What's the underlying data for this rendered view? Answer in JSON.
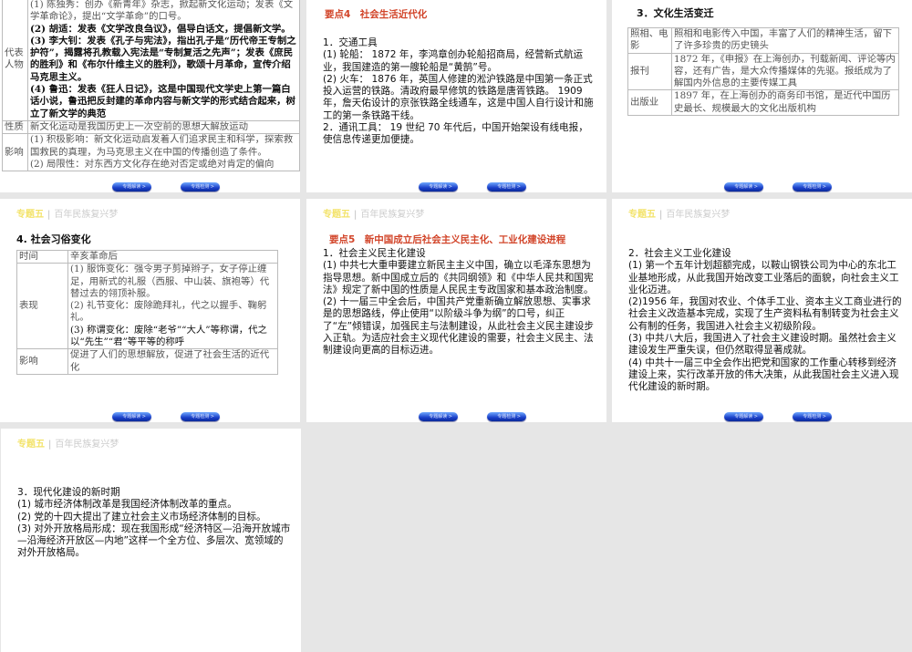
{
  "header": {
    "topic": "专题五",
    "separator": "|",
    "subtitle": "百年民族复兴梦"
  },
  "buttons": {
    "prev": "专题解读 >",
    "next": "专题检测 >"
  },
  "slide1": {
    "rep_label": "代表人物",
    "rep_items": [
      "(1) 陈独秀：创办《新青年》杂志，掀起新文化运动；发表《文学革命论》，提出“文学革命”的口号。",
      "(2) 胡适：发表《文学改良刍议》，倡导白话文，提倡新文学。",
      "(3) 李大钊：发表《孔子与宪法》，指出孔子是“历代帝王专制之护符”，揭露将孔教载入宪法是“专制复活之先声”；发表《庶民的胜利》和《布尔什维主义的胜利》，歌颂十月革命，宣传介绍马克思主义。",
      "(4) 鲁迅：发表《狂人日记》，这是中国现代文学史上第一篇白话小说，鲁迅把反封建的革命内容与新文学的形式结合起来，树立了新文学的典范"
    ],
    "nature_label": "性质",
    "nature": "新文化运动是我国历史上一次空前的思想大解放运动",
    "impact_label": "影响",
    "impact_items": [
      "(1) 积极影响：新文化运动启发着人们追求民主和科学，探索救国救民的真理，为马克思主义在中国的传播创造了条件。",
      "(2) 局限性：对东西方文化存在绝对否定或绝对肯定的偏向"
    ]
  },
  "slide2": {
    "title": "要点4　社会生活近代化",
    "paras": [
      "1．交通工具",
      "(1) 轮船： 1872 年，李鸿章创办轮船招商局，经营新式航运业，我国建造的第一艘轮船是“黄鹄”号。",
      "(2) 火车： 1876 年，英国人修建的淞沪铁路是中国第一条正式投入运营的铁路。清政府最早修筑的铁路是唐胥铁路。 1909 年，詹天佑设计的京张铁路全线通车，这是中国人自行设计和施工的第一条铁路干线。",
      "2．通讯工具： 19 世纪 70 年代后，中国开始架设有线电报，使信息传递更加便捷。"
    ]
  },
  "slide3": {
    "title": "3．文化生活变迁",
    "rows": [
      [
        "照相、电影",
        "照相和电影传入中国，丰富了人们的精神生活，留下了许多珍贵的历史镜头"
      ],
      [
        "报刊",
        "1872 年，《申报》在上海创办，刊载新闻、评论等内容，还有广告，是大众传播媒体的先驱。报纸成为了解国内外信息的主要传媒工具"
      ],
      [
        "出版业",
        "1897 年，在上海创办的商务印书馆，是近代中国历史最长、规模最大的文化出版机构"
      ]
    ]
  },
  "slide4": {
    "title": "4. 社会习俗变化",
    "time_label": "时间",
    "time": "辛亥革命后",
    "show_label": "表现",
    "show_items": [
      "(1) 服饰变化：强令男子剪掉辫子，女子停止缠足，用新式的礼服（西服、中山装、旗袍等）代替过去的翎顶补服。",
      "(2) 礼节变化：废除跪拜礼，代之以握手、鞠躬礼。",
      "(3) 称谓变化：废除“老爷”“大人”等称谓，代之以“先生”“君”等平等的称呼"
    ],
    "impact_label": "影响",
    "impact": "促进了人们的思想解放，促进了社会生活的近代化"
  },
  "slide5": {
    "title": "要点5　新中国成立后社会主义民主化、工业化建设进程",
    "paras": [
      "1．社会主义民主化建设",
      "(1) 中共七大重申要建立新民主主义中国，确立以毛泽东思想为指导思想。新中国成立后的《共同纲领》和《中华人民共和国宪法》规定了新中国的性质是人民民主专政国家和基本政治制度。",
      "(2) 十一届三中全会后，中国共产党重新确立解放思想、实事求是的思想路线，停止使用“以阶级斗争为纲”的口号，纠正了“左”倾错误，加强民主与法制建设，从此社会主义民主建设步入正轨。为适应社会主义现代化建设的需要，社会主义民主、法制建设向更高的目标迈进。"
    ]
  },
  "slide6": {
    "paras": [
      "2．社会主义工业化建设",
      "(1) 第一个五年计划超额完成，以鞍山钢铁公司为中心的东北工业基地形成，从此我国开始改变工业落后的面貌，向社会主义工业化迈进。",
      "(2)1956 年，我国对农业、个体手工业、资本主义工商业进行的社会主义改造基本完成，实现了生产资料私有制转变为社会主义公有制的任务，我国进入社会主义初级阶段。",
      "(3) 中共八大后，我国进入了社会主义建设时期。虽然社会主义建设发生严重失误，但仍然取得显著成就。",
      "(4) 中共十一届三中全会作出把党和国家的工作重心转移到经济建设上来，实行改革开放的伟大决策，从此我国社会主义进入现代化建设的新时期。"
    ]
  },
  "slide7": {
    "paras": [
      "3．现代化建设的新时期",
      "(1) 城市经济体制改革是我国经济体制改革的重点。",
      "(2) 党的十四大提出了建立社会主义市场经济体制的目标。",
      "(3) 对外开放格局形成：现在我国形成“经济特区—沿海开放城市—沿海经济开放区—内地”这样一个全方位、多层次、宽领域的对外开放格局。"
    ]
  }
}
